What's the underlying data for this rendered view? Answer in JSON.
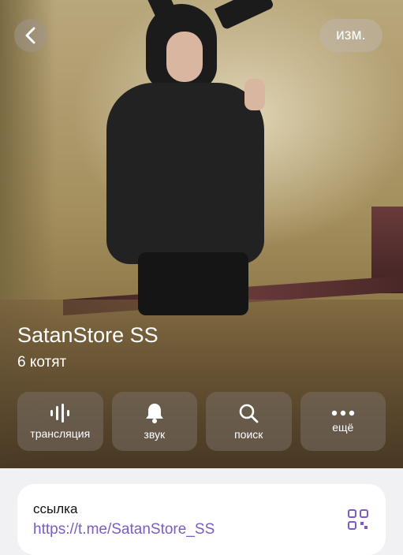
{
  "header": {
    "back_icon": "chevron-left-icon",
    "edit_label": "изм."
  },
  "profile": {
    "name": "SatanStore SS",
    "subtitle": "6 котят"
  },
  "actions": [
    {
      "label": "трансляция",
      "icon": "broadcast-icon"
    },
    {
      "label": "звук",
      "icon": "bell-icon"
    },
    {
      "label": "поиск",
      "icon": "search-icon"
    },
    {
      "label": "ещё",
      "icon": "more-dots-icon"
    }
  ],
  "link_card": {
    "label": "ссылка",
    "url": "https://t.me/SatanStore_SS",
    "qr_icon": "qr-code-icon"
  },
  "colors": {
    "link": "#7b5bc4",
    "page_bg": "#f1f1f4"
  }
}
